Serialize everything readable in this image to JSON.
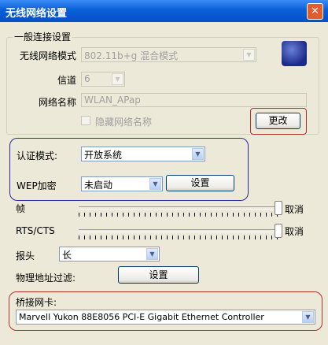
{
  "window": {
    "title": "无线网络设置",
    "close_glyph": "✕"
  },
  "general": {
    "legend": "一般连接设置",
    "mode_label": "无线网络模式",
    "mode_value": "802.11b+g 混合模式",
    "channel_label": "信道",
    "channel_value": "6",
    "ssid_label": "网络名称",
    "ssid_value": "WLAN_APap",
    "hide_ssid_label": "隐藏网络名称",
    "change_button": "更改",
    "icon": "network-adapter-icon"
  },
  "auth": {
    "mode_label": "认证模式:",
    "mode_value": "开放系统",
    "wep_label": "WEP加密",
    "wep_value": "未启动",
    "settings_button": "设置"
  },
  "frame": {
    "label": "帧",
    "cancel_label": "取消"
  },
  "rts": {
    "label": "RTS/CTS",
    "cancel_label": "取消"
  },
  "preamble": {
    "label": "报头",
    "value": "长"
  },
  "mac_filter": {
    "label": "物理地址过滤:",
    "button": "设置"
  },
  "bridge": {
    "label": "桥接网卡:",
    "value": "Marvell Yukon 88E8056 PCI-E Gigabit Ethernet Controller"
  },
  "colors": {
    "title_bar": "#0a5fd8",
    "highlight_red": "#b03030",
    "highlight_blue": "#2a2aa0",
    "dialog_bg": "#ece9d8"
  }
}
